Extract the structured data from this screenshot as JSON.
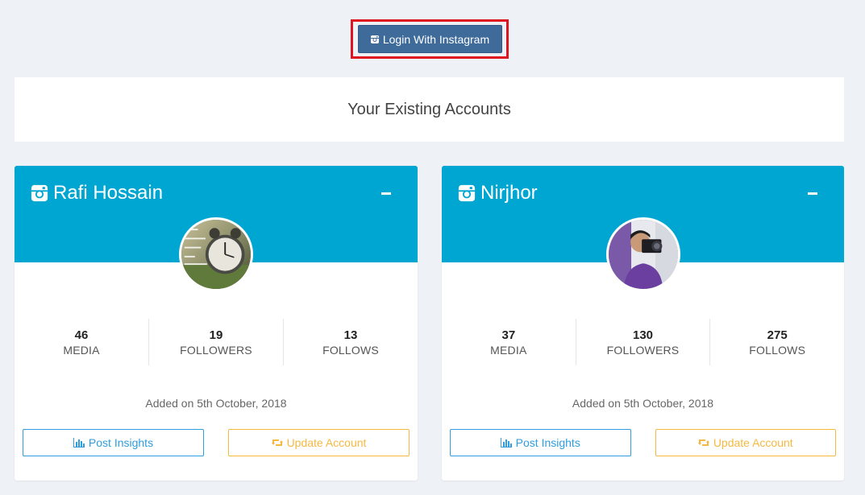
{
  "login_button": {
    "label": "Login With Instagram",
    "icon": "instagram-icon"
  },
  "existing_heading": "Your Existing Accounts",
  "colors": {
    "card_header": "#00a6d2",
    "login_button": "#3f6b9b",
    "highlight_border": "#e0141e",
    "insights": "#2f9de0",
    "update": "#f5b942"
  },
  "accounts": [
    {
      "name": "Rafi Hossain",
      "icon": "instagram-icon",
      "avatar_desc": "clock-photo-avatar",
      "stats": [
        {
          "value": "46",
          "label": "MEDIA"
        },
        {
          "value": "19",
          "label": "FOLLOWERS"
        },
        {
          "value": "13",
          "label": "FOLLOWS"
        }
      ],
      "added": "Added on 5th October, 2018",
      "insights_label": "Post Insights",
      "update_label": "Update Account"
    },
    {
      "name": "Nirjhor",
      "icon": "instagram-icon",
      "avatar_desc": "photographer-avatar",
      "stats": [
        {
          "value": "37",
          "label": "MEDIA"
        },
        {
          "value": "130",
          "label": "FOLLOWERS"
        },
        {
          "value": "275",
          "label": "FOLLOWS"
        }
      ],
      "added": "Added on 5th October, 2018",
      "insights_label": "Post Insights",
      "update_label": "Update Account"
    }
  ]
}
